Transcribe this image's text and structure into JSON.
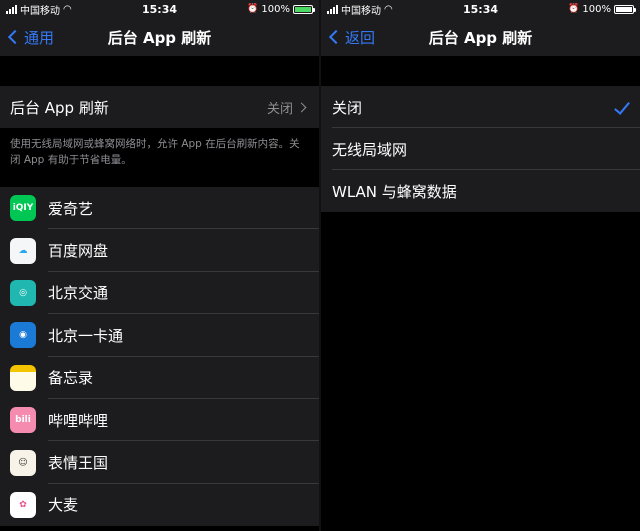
{
  "left": {
    "status": {
      "carrier": "中国移动",
      "time": "15:34",
      "battery": "100%"
    },
    "nav": {
      "back_label": "通用",
      "title": "后台 App 刷新"
    },
    "setting": {
      "label": "后台 App 刷新",
      "value": "关闭"
    },
    "footer": "使用无线局域网或蜂窝网络时，允许 App 在后台刷新内容。关闭 App 有助于节省电量。",
    "apps": [
      {
        "name": "爱奇艺",
        "icon": "iqiyi-icon",
        "glyph": "iQIY",
        "bg": "#00c653",
        "fg": "#ffffff"
      },
      {
        "name": "百度网盘",
        "icon": "baidu-netdisk-icon",
        "glyph": "☁",
        "bg": "#f4f6f8",
        "fg": "#2aa6f0"
      },
      {
        "name": "北京交通",
        "icon": "beijing-transport-icon",
        "glyph": "◎",
        "bg": "#1fb7b0",
        "fg": "#ffffff"
      },
      {
        "name": "北京一卡通",
        "icon": "beijing-card-icon",
        "glyph": "◉",
        "bg": "#1a7ad6",
        "fg": "#ffffff"
      },
      {
        "name": "备忘录",
        "icon": "notes-icon",
        "glyph": "",
        "bg": "#fefbe9",
        "fg": "#f5c400"
      },
      {
        "name": "哔哩哔哩",
        "icon": "bilibili-icon",
        "glyph": "bili",
        "bg": "#f58cb0",
        "fg": "#ffffff"
      },
      {
        "name": "表情王国",
        "icon": "emoji-kingdom-icon",
        "glyph": "☺",
        "bg": "#f7f3e8",
        "fg": "#333333"
      },
      {
        "name": "大麦",
        "icon": "damai-icon",
        "glyph": "✿",
        "bg": "#ffffff",
        "fg": "#e84d8a"
      }
    ]
  },
  "right": {
    "status": {
      "carrier": "中国移动",
      "time": "15:34",
      "battery": "100%"
    },
    "nav": {
      "back_label": "返回",
      "title": "后台 App 刷新"
    },
    "options": [
      {
        "label": "关闭",
        "selected": true
      },
      {
        "label": "无线局域网",
        "selected": false
      },
      {
        "label": "WLAN 与蜂窝数据",
        "selected": false
      }
    ]
  },
  "colors": {
    "accent": "#3478f6",
    "group_bg": "#1c1c1e",
    "secondary_text": "#8e8e93"
  }
}
